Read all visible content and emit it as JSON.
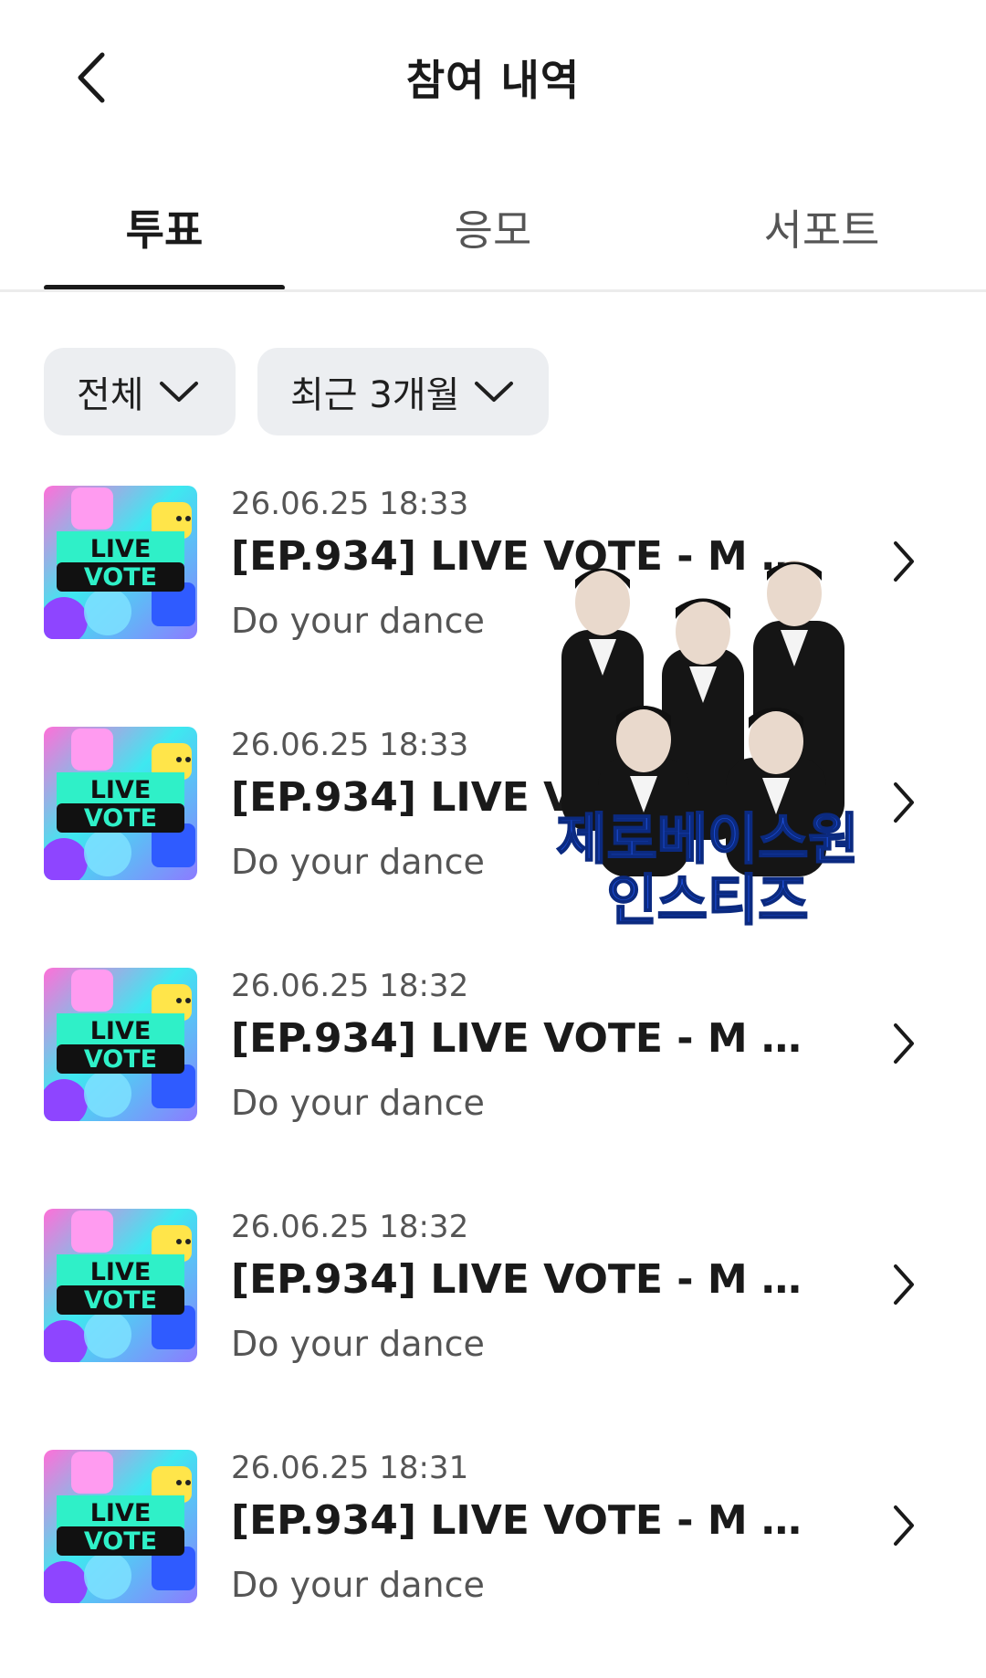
{
  "header": {
    "title": "참여 내역",
    "back_icon": "chevron-left-icon"
  },
  "tabs": [
    {
      "label": "투표",
      "active": true
    },
    {
      "label": "응모",
      "active": false
    },
    {
      "label": "서포트",
      "active": false
    }
  ],
  "filters": {
    "category": "전체",
    "period": "최근 3개월"
  },
  "thumbnail": {
    "line1": "LIVE",
    "line2": "VOTE"
  },
  "items": [
    {
      "date": "26.06.25 18:33",
      "title": "[EP.934] LIVE VOTE - M CO...",
      "subtitle": "Do your dance"
    },
    {
      "date": "26.06.25 18:33",
      "title": "[EP.934] LIVE VOTE - M CO...",
      "subtitle": "Do your dance"
    },
    {
      "date": "26.06.25 18:32",
      "title": "[EP.934] LIVE VOTE - M CO...",
      "subtitle": "Do your dance"
    },
    {
      "date": "26.06.25 18:32",
      "title": "[EP.934] LIVE VOTE - M CO...",
      "subtitle": "Do your dance"
    },
    {
      "date": "26.06.25 18:31",
      "title": "[EP.934] LIVE VOTE - M CO...",
      "subtitle": "Do your dance"
    }
  ],
  "overlay": {
    "line1": "제로베이스원",
    "line2": "인스티즈"
  },
  "colors": {
    "text_primary": "#1a1a1a",
    "text_secondary": "#555555",
    "filter_bg": "#eceef1",
    "overlay_text": "#1d4ed8"
  }
}
